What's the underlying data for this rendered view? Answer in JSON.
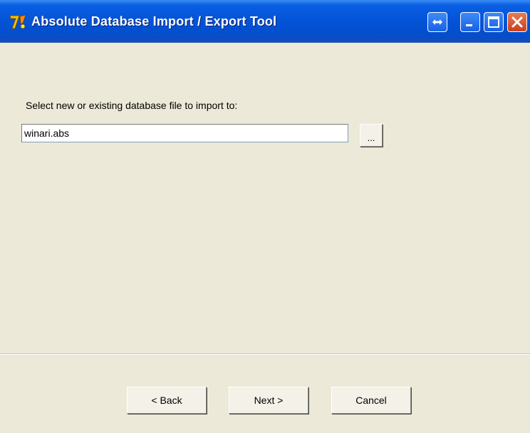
{
  "window": {
    "title": "Absolute Database Import / Export Tool",
    "app_icon": "app-logo-icon",
    "controls": [
      "resize-toggle-icon",
      "minimize-icon",
      "maximize-icon",
      "close-icon"
    ],
    "colors": {
      "titlebar": "#0454D8",
      "client_bg": "#ECE9D8",
      "close_btn": "#D9542A"
    }
  },
  "main": {
    "prompt": "Select new or existing database file to import to:",
    "file_path": {
      "value": "winari.abs",
      "placeholder": ""
    },
    "browse_label": "..."
  },
  "footer": {
    "back_label": "< Back",
    "next_label": "Next >",
    "cancel_label": "Cancel"
  }
}
